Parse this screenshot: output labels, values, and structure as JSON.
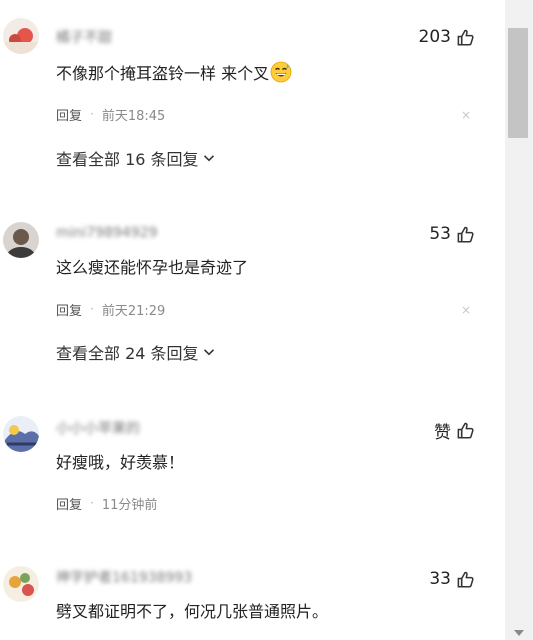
{
  "comments": [
    {
      "username": "橘子不甜",
      "likes": "203",
      "text": "不像那个掩耳盗铃一样 来个叉",
      "emoji_icon": "grinning-sweat-emoji",
      "reply_label": "回复",
      "time": "前天18:45",
      "expand_label": "查看全部 16 条回复"
    },
    {
      "username": "mini79894929",
      "likes": "53",
      "text": "这么瘦还能怀孕也是奇迹了",
      "reply_label": "回复",
      "time": "前天21:29",
      "expand_label": "查看全部 24 条回复"
    },
    {
      "username": "小小小苹果的",
      "likes": "赞",
      "text": "好瘦哦，好羡慕！",
      "reply_label": "回复",
      "time": "11分钟前"
    },
    {
      "username": "神字护者161938993",
      "likes": "33",
      "text": "劈叉都证明不了，何况几张普通照片。"
    }
  ],
  "close_glyph": "×"
}
